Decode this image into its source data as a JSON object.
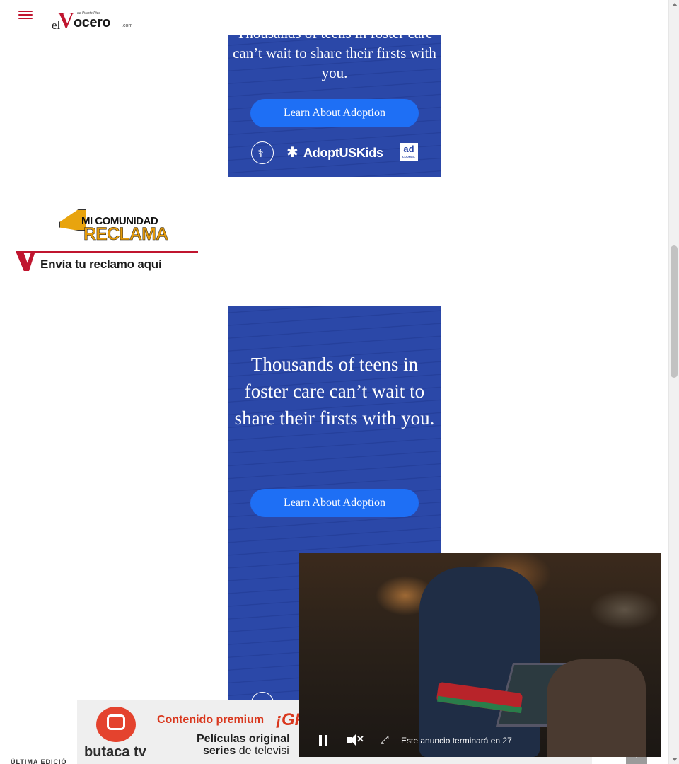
{
  "header": {
    "menu_label": "",
    "logo": {
      "prefix": "el",
      "initial": "V",
      "word": "ocero",
      "suffix": ".com",
      "tagline": "de Puerto Rico"
    }
  },
  "ad_top": {
    "headline": "Thousands of teens in foster care can’t wait to share their firsts with you.",
    "cta": "Learn About Adoption",
    "partner": "AdoptUSKids",
    "council": "ad",
    "council_sub": "COUNCIL"
  },
  "reclama": {
    "line1": "MI COMUNIDAD",
    "line2": "RECLAMA",
    "cta": "Envía tu reclamo aquí"
  },
  "ad_middle": {
    "headline": "Thousands of teens in foster care can’t wait to share their firsts with you.",
    "cta": "Learn About Adoption"
  },
  "video": {
    "countdown": "Este anuncio terminará en 27",
    "muted": true,
    "playing": true
  },
  "butaca": {
    "brand": "butaca tv",
    "headline": "Contenido premium",
    "headline_big": "¡GR",
    "line1": "Películas original",
    "line2_bold": "series",
    "line2_rest": " de televisi"
  },
  "footer_peek": "ÚLTIMA EDICIÓ",
  "colors": {
    "brand_red": "#c0152f",
    "ad_blue": "#2b48a8",
    "cta_blue": "#1e6ff5",
    "butaca_orange": "#d9381e"
  }
}
